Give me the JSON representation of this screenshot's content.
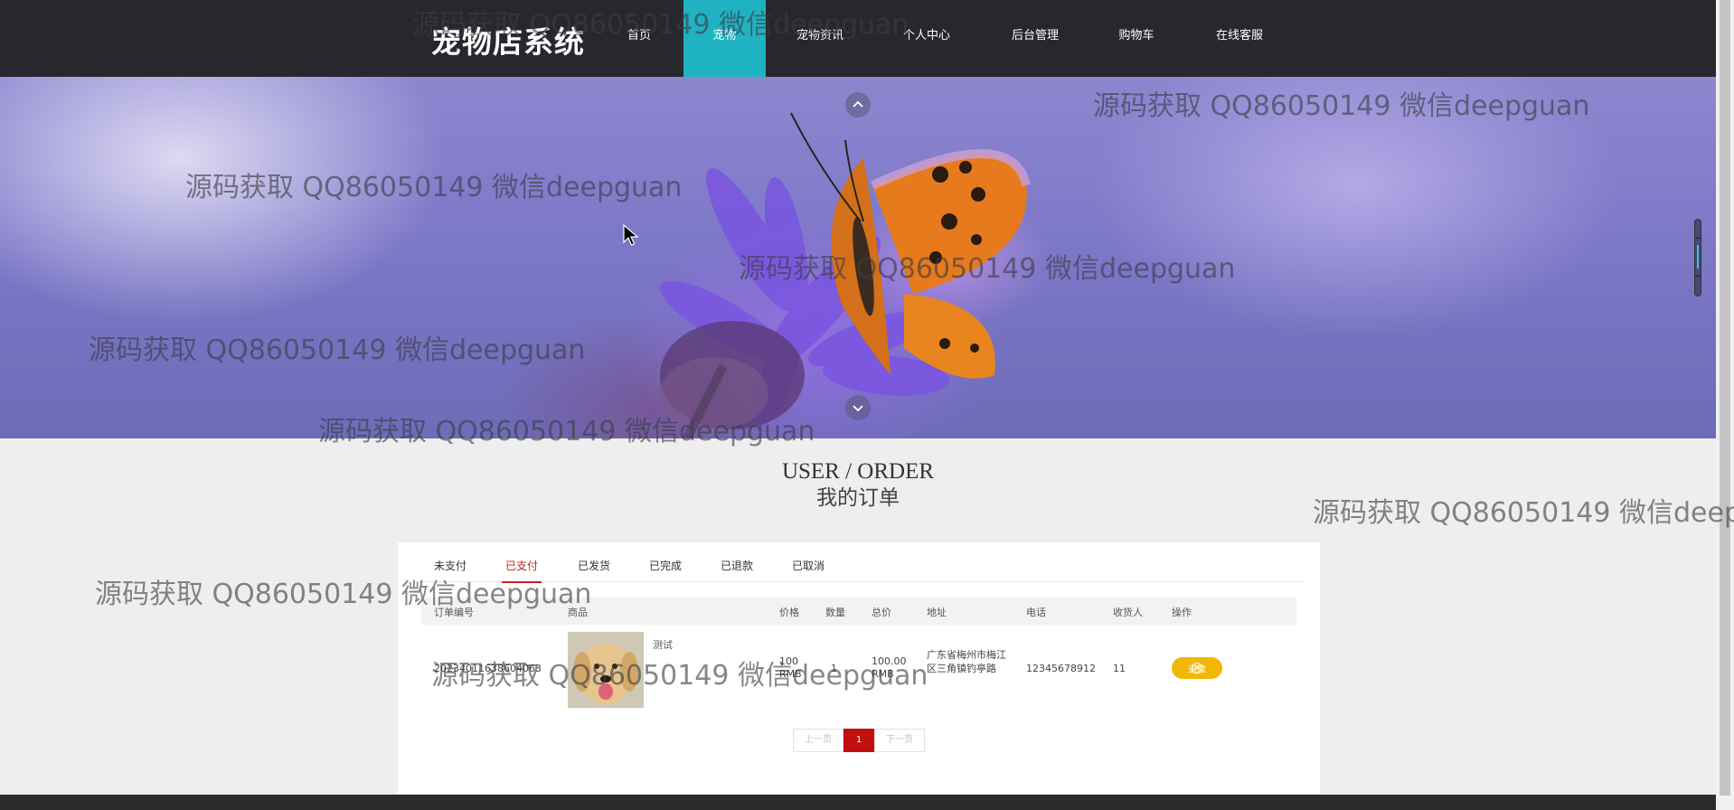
{
  "header": {
    "brand": "宠物店系统",
    "nav": [
      {
        "label": "首页",
        "active": false
      },
      {
        "label": "宠物",
        "active": true
      },
      {
        "label": "宠物资讯",
        "active": false
      },
      {
        "label": "个人中心",
        "active": false
      },
      {
        "label": "后台管理",
        "active": false
      },
      {
        "label": "购物车",
        "active": false
      },
      {
        "label": "在线客服",
        "active": false
      }
    ]
  },
  "banner": {
    "prev_icon": "chevron-up-icon",
    "next_icon": "chevron-down-icon"
  },
  "section": {
    "title_en": "USER / ORDER",
    "title_zh": "我的订单"
  },
  "orders": {
    "tabs": [
      {
        "label": "未支付",
        "active": false
      },
      {
        "label": "已支付",
        "active": true
      },
      {
        "label": "已发货",
        "active": false
      },
      {
        "label": "已完成",
        "active": false
      },
      {
        "label": "已退款",
        "active": false
      },
      {
        "label": "已取消",
        "active": false
      }
    ],
    "columns": [
      "订单编号",
      "商品",
      "价格",
      "数量",
      "总价",
      "地址",
      "电话",
      "收货人",
      "操作"
    ],
    "rows": [
      {
        "order_no": "20234011638604063",
        "product_name": "测试",
        "price": "100",
        "price_unit": "RMB",
        "quantity": "1",
        "total": "100.00",
        "total_unit": "RMB",
        "address": "广东省梅州市梅江区三角镇钓亭路",
        "phone": "12345678912",
        "receiver": "11",
        "action": "退款"
      }
    ],
    "pagination": {
      "prev": "上一页",
      "current": "1",
      "next": "下一页"
    }
  },
  "watermark_text": "源码获取 QQ86050149 微信deepguan",
  "colors": {
    "nav_bg": "#26282e",
    "nav_active": "#1fb3c1",
    "tab_active": "#c81e1e",
    "refund_button": "#f2b705",
    "page_current": "#c40f0f"
  }
}
